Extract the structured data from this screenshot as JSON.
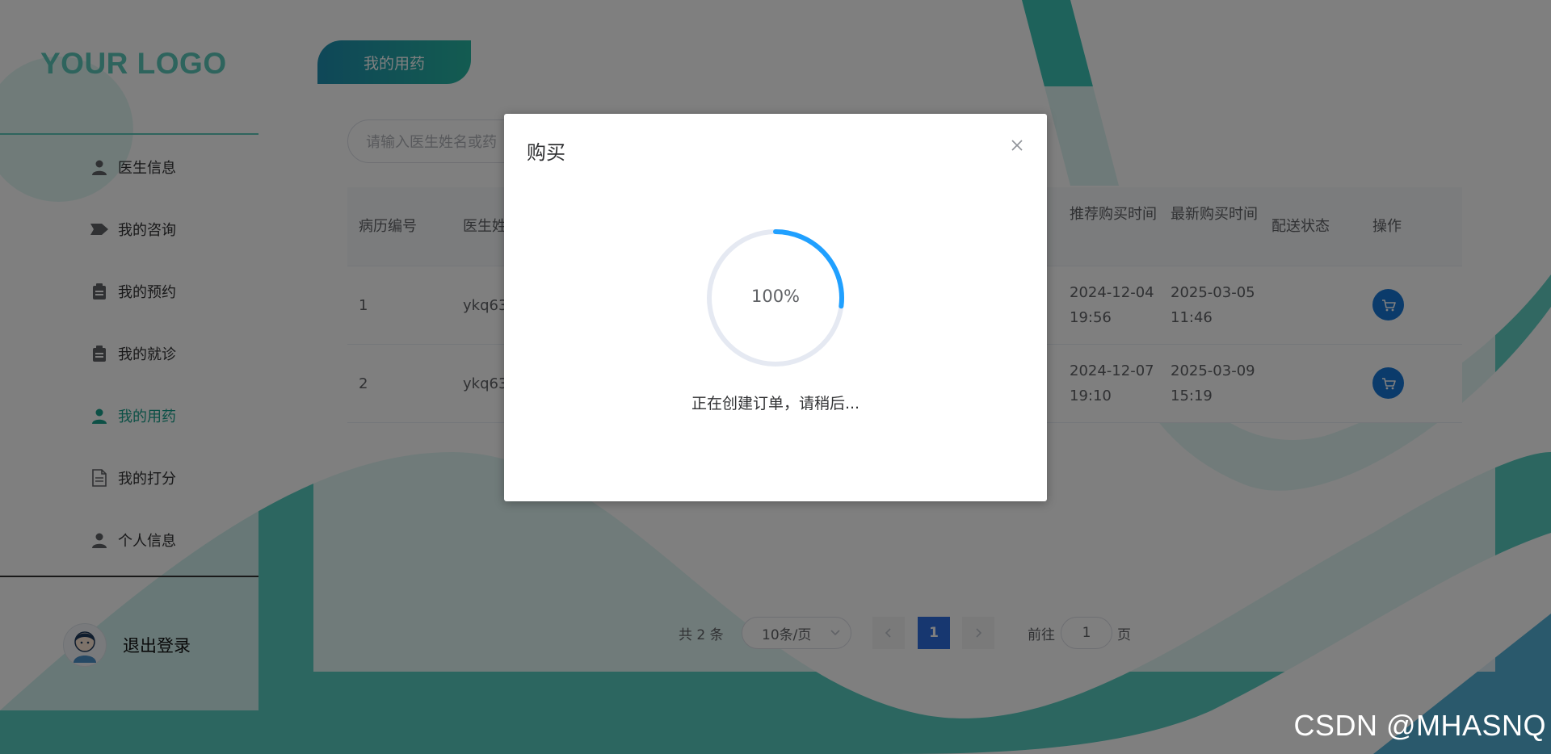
{
  "brand": {
    "logo_text": "YOUR LOGO"
  },
  "sidebar": {
    "items": [
      {
        "label": "医生信息",
        "icon": "user-icon",
        "active": false
      },
      {
        "label": "我的咨询",
        "icon": "ticket-icon",
        "active": false
      },
      {
        "label": "我的预约",
        "icon": "clipboard-icon",
        "active": false
      },
      {
        "label": "我的就诊",
        "icon": "clipboard-icon",
        "active": false
      },
      {
        "label": "我的用药",
        "icon": "user-icon",
        "active": true
      },
      {
        "label": "我的打分",
        "icon": "document-icon",
        "active": false
      },
      {
        "label": "个人信息",
        "icon": "user-icon",
        "active": false
      }
    ],
    "logout_label": "退出登录",
    "active_color": "#19a08c"
  },
  "main": {
    "tab_title": "我的用药",
    "search": {
      "placeholder": "请输入医生姓名或药"
    },
    "table": {
      "headers": [
        "病历编号",
        "医生姓",
        "推荐购买时间",
        "最新购买时间",
        "配送状态",
        "操作"
      ],
      "rows": [
        {
          "id": "1",
          "doctor": "ykq63",
          "recommend_time": "2024-12-04 19:56",
          "latest_time": "2025-03-05 11:46",
          "status": ""
        },
        {
          "id": "2",
          "doctor": "ykq63",
          "recommend_time": "2024-12-07 19:10",
          "latest_time": "2025-03-09 15:19",
          "status": ""
        }
      ]
    },
    "pagination": {
      "total": "共 2 条",
      "page_size": "10条/页",
      "current_page": "1",
      "goto_label": "前往",
      "goto_value": "1",
      "page_label": "页"
    }
  },
  "dialog": {
    "title": "购买",
    "progress_percent": 100,
    "progress_text": "100%",
    "message": "正在创建订单，请稍后...",
    "progress_color": "#20a0ff"
  },
  "watermark": "CSDN @MHASNQ"
}
